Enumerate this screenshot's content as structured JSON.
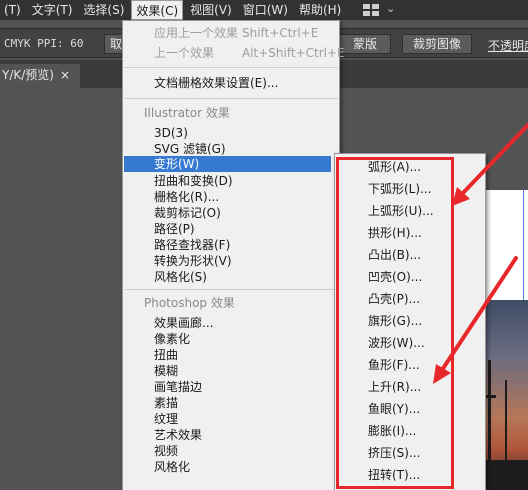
{
  "menubar": {
    "items": [
      "(T)",
      "文字(T)",
      "选择(S)",
      "效果(C)",
      "视图(V)",
      "窗口(W)",
      "帮助(H)"
    ],
    "active_index": 3
  },
  "control_bar": {
    "color_mode": "CMYK PPI: 60",
    "left_button": "取",
    "mask_button": "蒙版",
    "crop_button": "裁剪图像",
    "opacity_label": "不透明度"
  },
  "document_tab": {
    "title": "Y/K/预览)",
    "close_glyph": "×"
  },
  "effect_menu": {
    "apply_last": {
      "label": "应用上一个效果",
      "shortcut": "Shift+Ctrl+E"
    },
    "last_effect": {
      "label": "上一个效果",
      "shortcut": "Alt+Shift+Ctrl+E"
    },
    "raster_settings": "文档栅格效果设置(E)...",
    "illustrator_header": "Illustrator 效果",
    "illustrator_items": [
      "3D(3)",
      "SVG 滤镜(G)",
      "变形(W)",
      "扭曲和变换(D)",
      "栅格化(R)...",
      "裁剪标记(O)",
      "路径(P)",
      "路径查找器(F)",
      "转换为形状(V)",
      "风格化(S)"
    ],
    "highlighted_index": 2,
    "photoshop_header": "Photoshop 效果",
    "photoshop_items": [
      "效果画廊...",
      "像素化",
      "扭曲",
      "模糊",
      "画笔描边",
      "素描",
      "纹理",
      "艺术效果",
      "视频",
      "风格化"
    ]
  },
  "warp_submenu": {
    "items": [
      "弧形(A)...",
      "下弧形(L)...",
      "上弧形(U)...",
      "拱形(H)...",
      "凸出(B)...",
      "凹壳(O)...",
      "凸壳(P)...",
      "旗形(G)...",
      "波形(W)...",
      "鱼形(F)...",
      "上升(R)...",
      "鱼眼(Y)...",
      "膨胀(I)...",
      "挤压(S)...",
      "扭转(T)..."
    ]
  },
  "colors": {
    "highlight": "#3679d1",
    "annotation_red": "#e8272b",
    "menubar_bg": "#323232",
    "menu_bg": "#f0f0f0"
  }
}
